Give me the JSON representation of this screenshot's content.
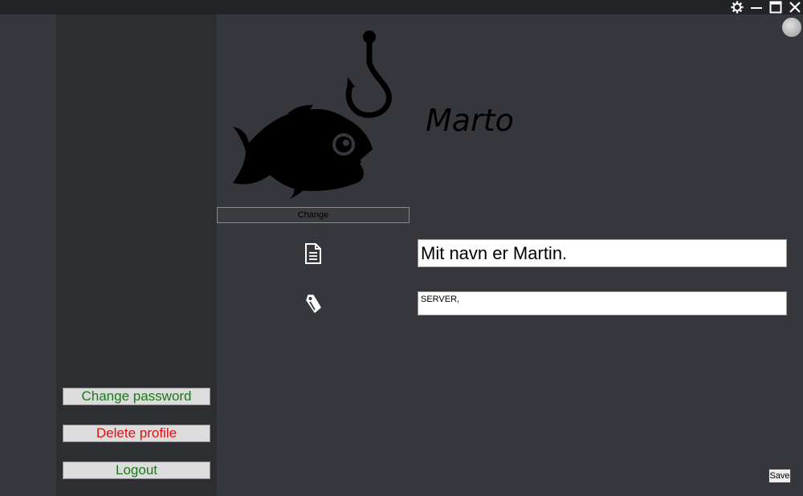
{
  "window": {
    "settings_icon": "gear-icon",
    "minimize_icon": "minimize-icon",
    "maximize_icon": "maximize-icon",
    "close_icon": "close-icon"
  },
  "profile": {
    "username": "Marto",
    "avatar_icon": "fish-hook-avatar-icon",
    "change_label": "Change",
    "description": "Mit navn er Martin.",
    "tags": "SERVER,",
    "description_icon": "document-icon",
    "tags_icon": "tag-icon"
  },
  "sidebar": {
    "change_password": "Change password",
    "delete_profile": "Delete profile",
    "logout": "Logout"
  },
  "footer": {
    "save_label": "Save"
  },
  "colors": {
    "green_text": "#1a7a1a",
    "red_text": "#e01010"
  }
}
